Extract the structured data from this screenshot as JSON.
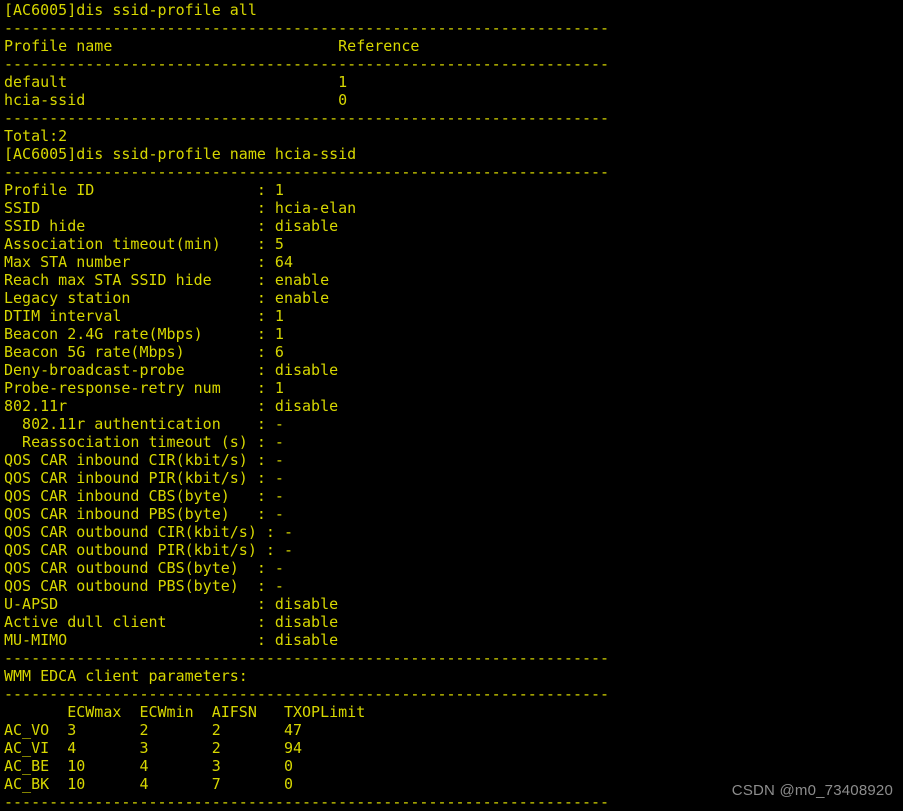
{
  "terminal": {
    "device_prompt": "[AC6005]",
    "foreground_color": "#d7d700",
    "background_color": "#000000",
    "separator_char": "-",
    "separator_width": 67,
    "commands": [
      "dis ssid-profile all",
      "dis ssid-profile name hcia-ssid"
    ],
    "profile_list": {
      "headers": [
        "Profile name",
        "Reference"
      ],
      "rows": [
        {
          "name": "default",
          "reference": "1"
        },
        {
          "name": "hcia-ssid",
          "reference": "0"
        }
      ],
      "total_label": "Total:2"
    },
    "profile_detail": {
      "fields": [
        {
          "key": "Profile ID",
          "value": "1",
          "indent": 0
        },
        {
          "key": "SSID",
          "value": "hcia-elan",
          "indent": 0
        },
        {
          "key": "SSID hide",
          "value": "disable",
          "indent": 0
        },
        {
          "key": "Association timeout(min)",
          "value": "5",
          "indent": 0
        },
        {
          "key": "Max STA number",
          "value": "64",
          "indent": 0
        },
        {
          "key": "Reach max STA SSID hide",
          "value": "enable",
          "indent": 0
        },
        {
          "key": "Legacy station",
          "value": "enable",
          "indent": 0
        },
        {
          "key": "DTIM interval",
          "value": "1",
          "indent": 0
        },
        {
          "key": "Beacon 2.4G rate(Mbps)",
          "value": "1",
          "indent": 0
        },
        {
          "key": "Beacon 5G rate(Mbps)",
          "value": "6",
          "indent": 0
        },
        {
          "key": "Deny-broadcast-probe",
          "value": "disable",
          "indent": 0
        },
        {
          "key": "Probe-response-retry num",
          "value": "1",
          "indent": 0
        },
        {
          "key": "802.11r",
          "value": "disable",
          "indent": 0
        },
        {
          "key": "802.11r authentication",
          "value": "-",
          "indent": 2
        },
        {
          "key": "Reassociation timeout (s)",
          "value": "-",
          "indent": 2
        },
        {
          "key": "QOS CAR inbound CIR(kbit/s)",
          "value": "-",
          "indent": 0
        },
        {
          "key": "QOS CAR inbound PIR(kbit/s)",
          "value": "-",
          "indent": 0
        },
        {
          "key": "QOS CAR inbound CBS(byte)",
          "value": "-",
          "indent": 0
        },
        {
          "key": "QOS CAR inbound PBS(byte)",
          "value": "-",
          "indent": 0
        },
        {
          "key": "QOS CAR outbound CIR(kbit/s)",
          "value": "-",
          "indent": 0
        },
        {
          "key": "QOS CAR outbound PIR(kbit/s)",
          "value": "-",
          "indent": 0
        },
        {
          "key": "QOS CAR outbound CBS(byte)",
          "value": "-",
          "indent": 0
        },
        {
          "key": "QOS CAR outbound PBS(byte)",
          "value": "-",
          "indent": 0
        },
        {
          "key": "U-APSD",
          "value": "disable",
          "indent": 0
        },
        {
          "key": "Active dull client",
          "value": "disable",
          "indent": 0
        },
        {
          "key": "MU-MIMO",
          "value": "disable",
          "indent": 0
        }
      ]
    },
    "edca": {
      "title": "WMM EDCA client parameters:",
      "headers": [
        "",
        "ECWmax",
        "ECWmin",
        "AIFSN",
        "TXOPLimit"
      ],
      "rows": [
        {
          "ac": "AC_VO",
          "ecwmax": "3",
          "ecwmin": "2",
          "aifsn": "2",
          "txoplimit": "47"
        },
        {
          "ac": "AC_VI",
          "ecwmax": "4",
          "ecwmin": "3",
          "aifsn": "2",
          "txoplimit": "94"
        },
        {
          "ac": "AC_BE",
          "ecwmax": "10",
          "ecwmin": "4",
          "aifsn": "3",
          "txoplimit": "0"
        },
        {
          "ac": "AC_BK",
          "ecwmax": "10",
          "ecwmin": "4",
          "aifsn": "7",
          "txoplimit": "0"
        }
      ]
    }
  },
  "watermark": {
    "text": "CSDN @m0_73408920",
    "color": "#8d8d8d"
  }
}
